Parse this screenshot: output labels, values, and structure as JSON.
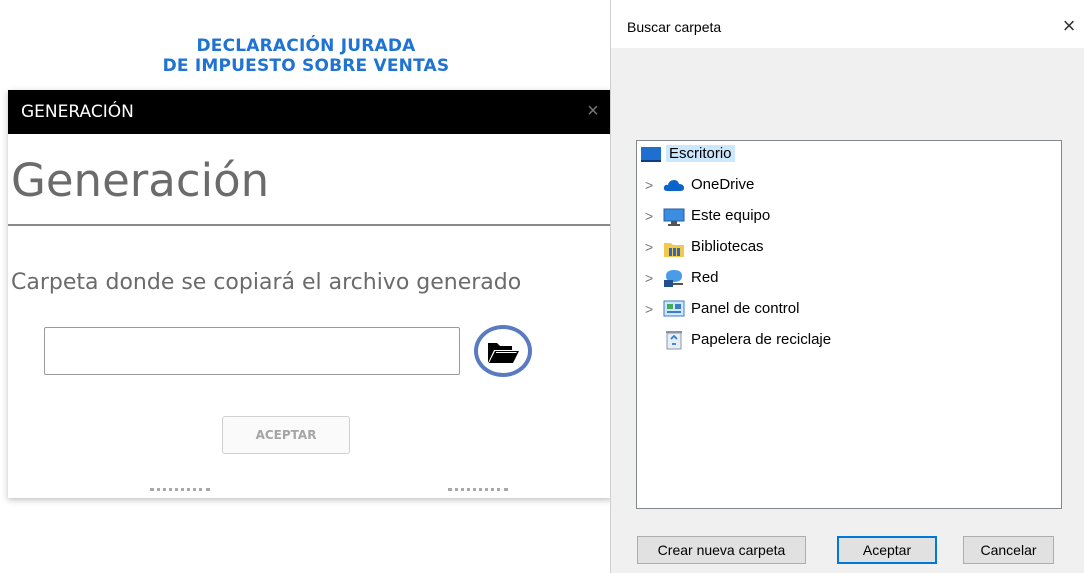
{
  "app": {
    "title_line1": "DECLARACIÓN JURADA",
    "title_line2": "DE IMPUESTO SOBRE VENTAS"
  },
  "generation_panel": {
    "titlebar": "GENERACIÓN",
    "close_glyph": "×",
    "heading": "Generación",
    "folder_label": "Carpeta donde se copiará el archivo generado",
    "folder_input_value": "",
    "accept_label": "ACEPTAR"
  },
  "folder_dialog": {
    "title": "Buscar carpeta",
    "close_glyph": "×",
    "tree": [
      {
        "label": "Escritorio",
        "icon": "desktop-icon",
        "expandable": false,
        "selected": true
      },
      {
        "label": "OneDrive",
        "icon": "onedrive-cloud-icon",
        "expandable": true,
        "selected": false
      },
      {
        "label": "Este equipo",
        "icon": "computer-icon",
        "expandable": true,
        "selected": false
      },
      {
        "label": "Bibliotecas",
        "icon": "libraries-icon",
        "expandable": true,
        "selected": false
      },
      {
        "label": "Red",
        "icon": "network-icon",
        "expandable": true,
        "selected": false
      },
      {
        "label": "Panel de control",
        "icon": "control-panel-icon",
        "expandable": true,
        "selected": false
      },
      {
        "label": "Papelera de reciclaje",
        "icon": "recycle-bin-icon",
        "expandable": false,
        "selected": false
      }
    ],
    "buttons": {
      "new_folder": "Crear nueva carpeta",
      "accept": "Aceptar",
      "cancel": "Cancelar"
    }
  },
  "colors": {
    "app_title": "#1f73d2",
    "titlebar_bg": "#000000",
    "selection_bg": "#cce8ff",
    "default_button_border": "#0078d7"
  }
}
